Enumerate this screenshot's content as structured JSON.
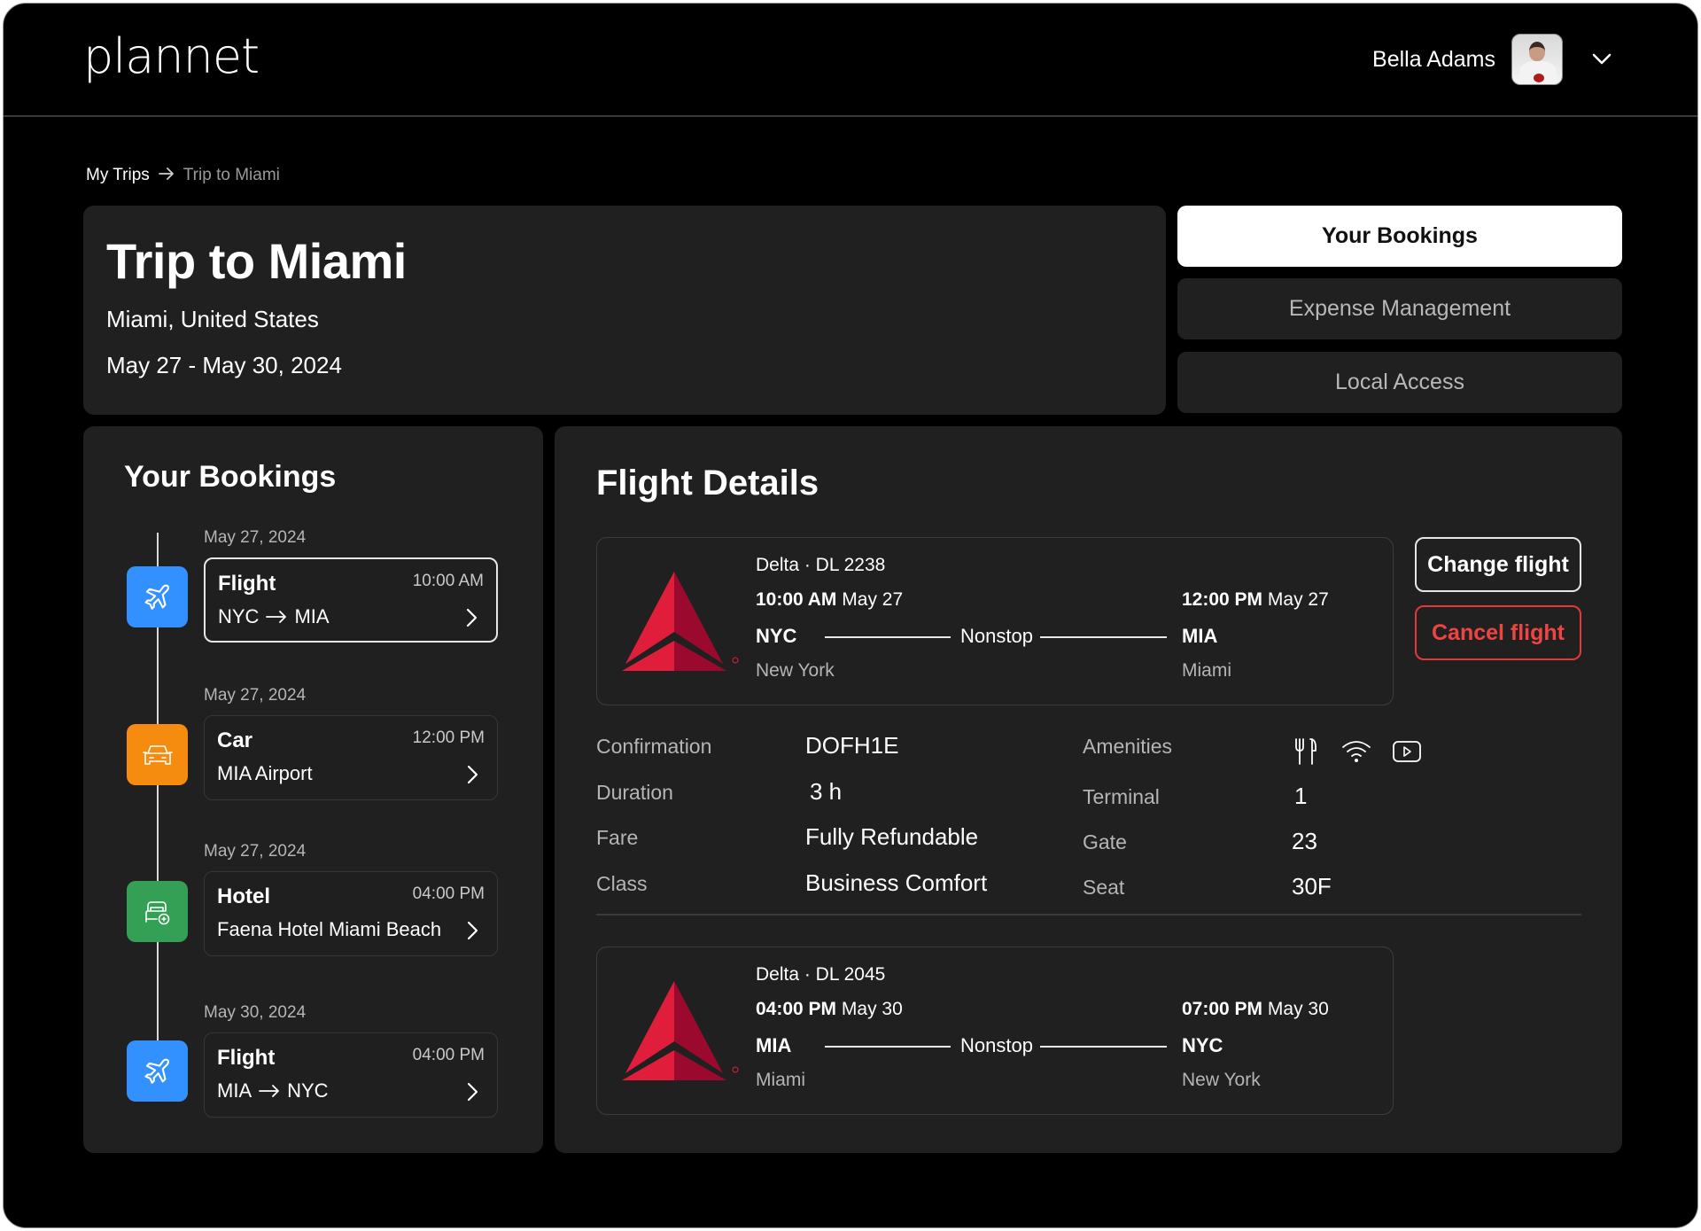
{
  "app": {
    "logo": "plannet",
    "user": {
      "name": "Bella Adams",
      "avatar": "avatar-photo",
      "menu_icon": "chevron-down-icon"
    }
  },
  "breadcrumb": {
    "items": [
      {
        "label": "My Trips"
      },
      {
        "label": "Trip to Miami"
      }
    ],
    "separator_icon": "arrow-right-icon"
  },
  "trip": {
    "title": "Trip to Miami",
    "location": "Miami, United States",
    "dates": "May 27 - May 30, 2024"
  },
  "tabs": [
    {
      "label": "Your Bookings",
      "active": true
    },
    {
      "label": "Expense Management",
      "active": false
    },
    {
      "label": "Local Access",
      "active": false
    }
  ],
  "bookings": {
    "title": "Your Bookings",
    "items": [
      {
        "date": "May 27, 2024",
        "type": "Flight",
        "time": "10:00 AM",
        "from": "NYC",
        "to": "MIA",
        "icon": "plane-icon",
        "color": "#3390ff",
        "selected": true
      },
      {
        "date": "May 27, 2024",
        "type": "Car",
        "time": "12:00 PM",
        "subtitle": "MIA Airport",
        "icon": "car-icon",
        "color": "#f68c0f",
        "selected": false
      },
      {
        "date": "May 27, 2024",
        "type": "Hotel",
        "time": "04:00 PM",
        "subtitle": "Faena Hotel Miami Beach",
        "icon": "hotel-bed-icon",
        "color": "#34a055",
        "selected": false
      },
      {
        "date": "May 30, 2024",
        "type": "Flight",
        "time": "04:00 PM",
        "from": "MIA",
        "to": "NYC",
        "icon": "plane-icon",
        "color": "#3390ff",
        "selected": false
      }
    ]
  },
  "flight_details": {
    "title": "Flight Details",
    "outbound": {
      "airline": "Delta · DL 2238",
      "dep_time": "10:00 AM",
      "dep_date": "May 27",
      "arr_time": "12:00 PM",
      "arr_date": "May 27",
      "dep_code": "NYC",
      "arr_code": "MIA",
      "dep_city": "New York",
      "arr_city": "Miami",
      "stops": "Nonstop"
    },
    "return": {
      "airline": "Delta · DL 2045",
      "dep_time": "04:00 PM",
      "dep_date": "May 30",
      "arr_time": "07:00 PM",
      "arr_date": "May 30",
      "dep_code": "MIA",
      "arr_code": "NYC",
      "dep_city": "Miami",
      "arr_city": "New York",
      "stops": "Nonstop"
    },
    "actions": {
      "change": "Change flight",
      "cancel": "Cancel flight"
    },
    "info": {
      "confirmation_label": "Confirmation",
      "confirmation": "DOFH1E",
      "duration_label": "Duration",
      "duration": "3 h",
      "fare_label": "Fare",
      "fare": "Fully Refundable",
      "class_label": "Class",
      "class": "Business Comfort",
      "amenities_label": "Amenities",
      "amenities": [
        "meal-icon",
        "wifi-icon",
        "video-icon"
      ],
      "terminal_label": "Terminal",
      "terminal": "1",
      "gate_label": "Gate",
      "gate": "23",
      "seat_label": "Seat",
      "seat": "30F"
    }
  },
  "colors": {
    "background": "#000000",
    "panel": "#202020",
    "flight": "#3390ff",
    "car": "#f68c0f",
    "hotel": "#34a055",
    "danger": "#ef4444",
    "delta_red": "#e01e3c",
    "delta_dark": "#9b0a2e"
  }
}
